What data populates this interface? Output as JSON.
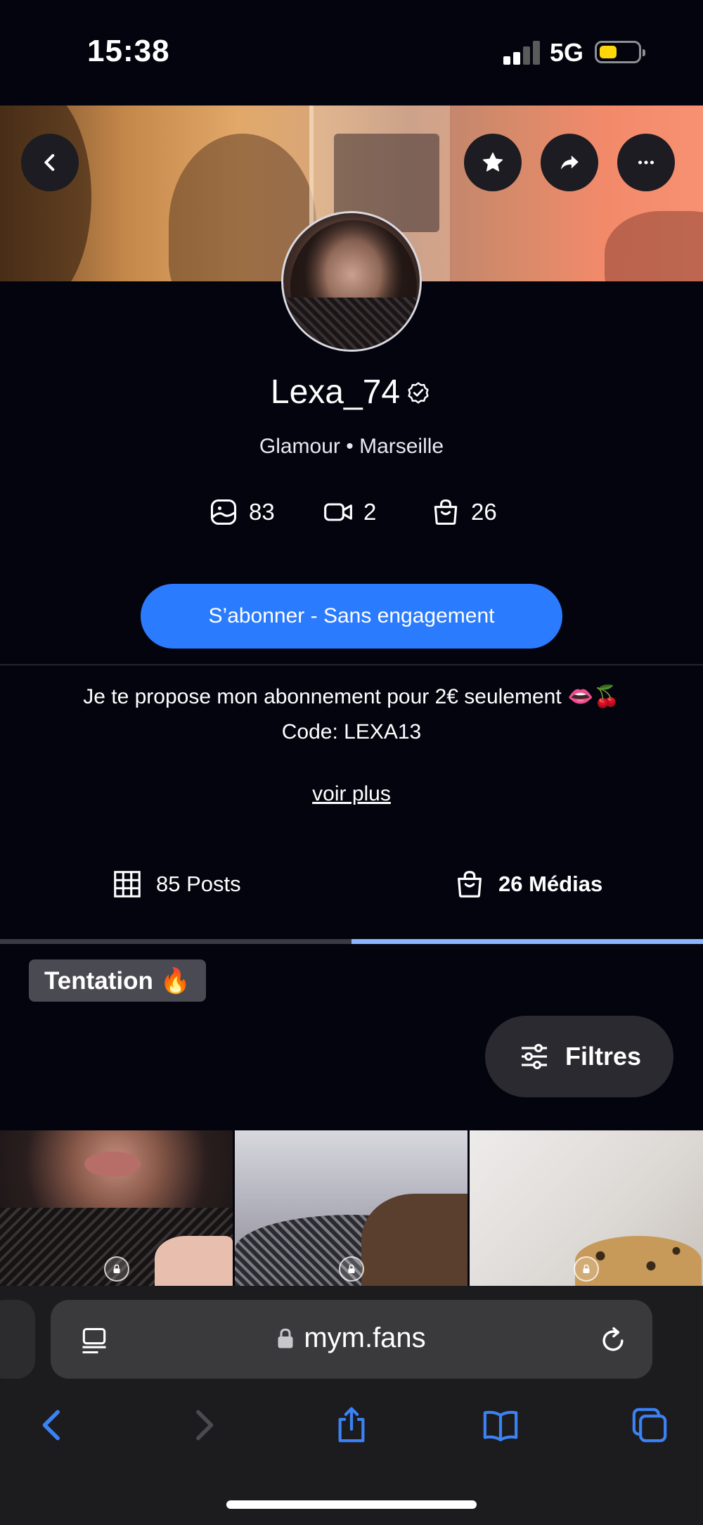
{
  "status_bar": {
    "time": "15:38",
    "network": "5G",
    "battery_level": 0.45,
    "battery_color": "#ffd60a"
  },
  "header": {
    "back_icon": "chevron-left-icon",
    "favorite_icon": "star-icon",
    "share_icon": "share-arrow-icon",
    "more_icon": "ellipsis-icon"
  },
  "profile": {
    "name": "Lexa_74",
    "verified_icon": "verified-check-icon",
    "subtitle": "Glamour • Marseille",
    "stats": [
      {
        "icon": "photo-icon",
        "value": "83"
      },
      {
        "icon": "video-icon",
        "value": "2"
      },
      {
        "icon": "shopping-bag-icon",
        "value": "26"
      }
    ]
  },
  "subscribe": {
    "label": "S’abonner - Sans engagement",
    "color": "#2b7bff"
  },
  "bio": {
    "line1": "Je te propose mon abonnement pour 2€ seulement 👄🍒",
    "line2": "Code: LEXA13",
    "see_more": "voir plus"
  },
  "tabs": [
    {
      "icon": "grid-icon",
      "label": "85 Posts",
      "active": false
    },
    {
      "icon": "shopping-bag-icon",
      "label": "26 Médias",
      "active": true
    }
  ],
  "tab_indicator_color": "#8db4ff",
  "collection": {
    "tag": "Tentation 🔥",
    "filter_label": "Filtres",
    "filter_icon": "sliders-icon",
    "media": [
      {
        "locked": true,
        "lock_icon": "lock-shield-icon"
      },
      {
        "locked": true,
        "lock_icon": "lock-shield-icon"
      },
      {
        "locked": true,
        "lock_icon": "lock-shield-icon"
      }
    ]
  },
  "browser": {
    "url": "mym.fans",
    "reader_icon": "reader-mode-icon",
    "reload_icon": "reload-icon",
    "toolbar": [
      "back-icon",
      "forward-icon",
      "share-icon",
      "bookmarks-icon",
      "tabs-icon"
    ],
    "accent": "#3b82f6"
  }
}
